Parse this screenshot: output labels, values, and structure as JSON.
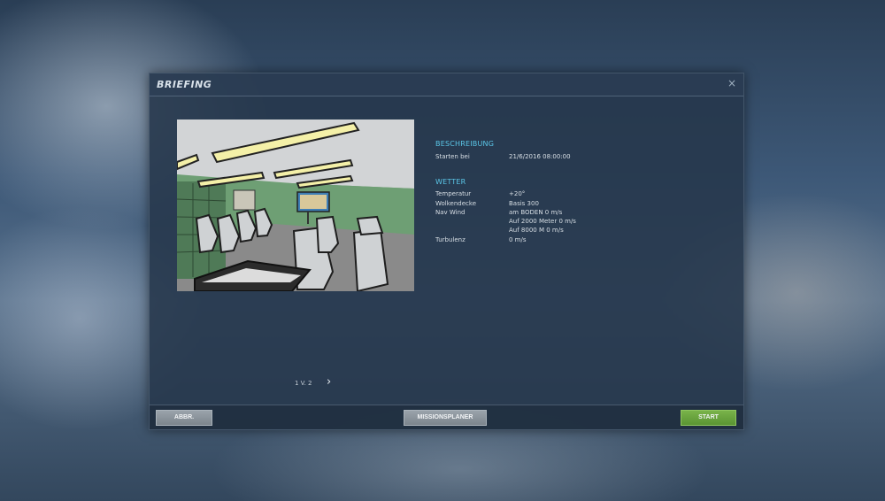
{
  "dialog": {
    "title": "BRIEFING",
    "close_glyph": "×"
  },
  "description": {
    "section_title": "BESCHREIBUNG",
    "start_label": "Starten bei",
    "start_value": "21/6/2016  08:00:00"
  },
  "weather": {
    "section_title": "WETTER",
    "temperature_label": "Temperatur",
    "temperature_value": "+20°",
    "clouds_label": "Wolkendecke",
    "clouds_value": "Basis 300",
    "wind_label": "Nav Wind",
    "wind_values": [
      "am BODEN 0 m/s",
      "Auf 2000 Meter 0 m/s",
      "Auf 8000 M 0 m/s"
    ],
    "turbulence_label": "Turbulenz",
    "turbulence_value": "0 m/s"
  },
  "pager": {
    "text": "1 V. 2",
    "next_glyph": "›"
  },
  "footer": {
    "cancel_label": "ABBR.",
    "planner_label": "MISSIONSPLANER",
    "start_label": "START"
  },
  "colors": {
    "accent_title": "#5bc7e8",
    "start_button": "#6aa33e"
  },
  "icons": {
    "close": "close-icon",
    "next": "chevron-right-icon"
  }
}
